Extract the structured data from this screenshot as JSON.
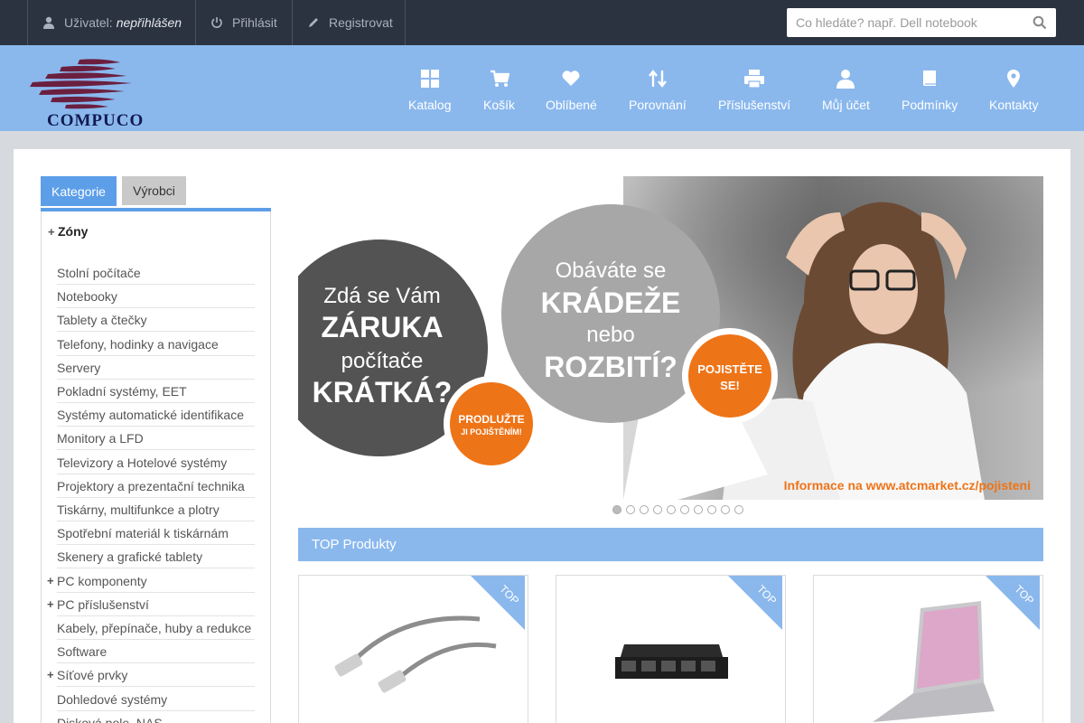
{
  "topbar": {
    "user_label": "Uživatel:",
    "user_value": "nepřihlášen",
    "login": "Přihlásit",
    "register": "Registrovat",
    "search_placeholder": "Co hledáte? např. Dell notebook"
  },
  "logo": {
    "text": "COMPUCO"
  },
  "nav": [
    {
      "label": "Katalog",
      "icon": "grid-icon"
    },
    {
      "label": "Košík",
      "icon": "cart-icon"
    },
    {
      "label": "Oblíbené",
      "icon": "heart-icon"
    },
    {
      "label": "Porovnání",
      "icon": "sort-arrows-icon"
    },
    {
      "label": "Příslušenství",
      "icon": "printer-icon"
    },
    {
      "label": "Můj účet",
      "icon": "user-icon"
    },
    {
      "label": "Podmínky",
      "icon": "book-icon"
    },
    {
      "label": "Kontakty",
      "icon": "map-pin-icon"
    }
  ],
  "sidebar": {
    "tab_categories": "Kategorie",
    "tab_manufacturers": "Výrobci",
    "zones": "Zóny",
    "items": [
      {
        "label": "Stolní počítače",
        "expand": false
      },
      {
        "label": "Notebooky",
        "expand": false
      },
      {
        "label": "Tablety a čtečky",
        "expand": false
      },
      {
        "label": "Telefony, hodinky a navigace",
        "expand": false
      },
      {
        "label": "Servery",
        "expand": false
      },
      {
        "label": "Pokladní systémy, EET",
        "expand": false
      },
      {
        "label": "Systémy automatické identifikace",
        "expand": false
      },
      {
        "label": "Monitory a LFD",
        "expand": false
      },
      {
        "label": "Televizory a Hotelové systémy",
        "expand": false
      },
      {
        "label": "Projektory a prezentační technika",
        "expand": false
      },
      {
        "label": "Tiskárny, multifunkce a plotry",
        "expand": false
      },
      {
        "label": "Spotřební materiál k tiskárnám",
        "expand": false
      },
      {
        "label": "Skenery a grafické tablety",
        "expand": false
      },
      {
        "label": "PC komponenty",
        "expand": true
      },
      {
        "label": "PC příslušenství",
        "expand": true
      },
      {
        "label": "Kabely, přepínače, huby a redukce",
        "expand": false
      },
      {
        "label": "Software",
        "expand": false
      },
      {
        "label": "Síťové prvky",
        "expand": true
      },
      {
        "label": "Dohledové systémy",
        "expand": false
      },
      {
        "label": "Disková pole, NAS",
        "expand": false
      }
    ]
  },
  "banner": {
    "c1_line1": "Zdá se Vám",
    "c1_line2": "ZÁRUKA",
    "c1_line3": "počítače",
    "c1_line4": "KRÁTKÁ?",
    "badge1_line1": "PRODLUŽTE",
    "badge1_line2": "JI POJIŠTĚNÍM!",
    "c2_line1": "Obáváte se",
    "c2_line2": "KRÁDEŽE",
    "c2_line3": "nebo",
    "c2_line4": "ROZBITÍ?",
    "badge2_line1": "POJISTĚTE",
    "badge2_line2": "SE!",
    "info": "Informace na www.atcmarket.cz/pojisteni",
    "slide_count": 10,
    "active_slide": 1
  },
  "top_products": {
    "title": "TOP Produkty",
    "ribbon": "TOP",
    "items": [
      {
        "kind": "network-cable"
      },
      {
        "kind": "network-switch"
      },
      {
        "kind": "laptop"
      }
    ]
  },
  "colors": {
    "topbar": "#2b3240",
    "header": "#8ab8ed",
    "accent": "#5d9ee8",
    "orange": "#ee7418"
  }
}
